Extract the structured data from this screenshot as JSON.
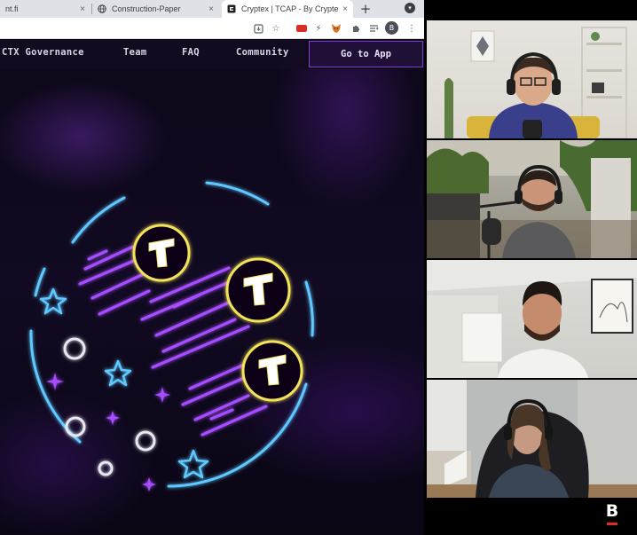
{
  "browser": {
    "tabs": [
      {
        "title": "nt.fi",
        "icon": "generic-page-icon"
      },
      {
        "title": "Construction-Paper",
        "icon": "globe-icon"
      },
      {
        "title": "Cryptex | TCAP - By Crypte",
        "icon": "cryptex-logo-icon",
        "active": true
      }
    ],
    "new_tab_label": "+",
    "profile_initial": "B",
    "toolbar_icons": [
      "install-icon",
      "star-icon",
      "extension-red-icon",
      "lightning-icon",
      "metamask-fox-icon",
      "puzzle-icon",
      "reading-list-icon"
    ]
  },
  "site": {
    "nav": {
      "governance": "CTX Governance",
      "team": "Team",
      "faq": "FAQ",
      "community": "Community",
      "cta": "Go to App"
    },
    "hero_tokens": [
      {
        "label": "T"
      },
      {
        "label": "T"
      },
      {
        "label": "T"
      }
    ],
    "colors": {
      "neon_purple": "#a64dff",
      "neon_blue": "#5ec8ff",
      "token_gold": "#f2e35a",
      "background": "#0c0616"
    }
  },
  "video_call": {
    "participants": [
      {
        "label": "participant-1"
      },
      {
        "label": "participant-2"
      },
      {
        "label": "participant-3"
      },
      {
        "label": "participant-4"
      }
    ],
    "brand_letter": "B"
  }
}
